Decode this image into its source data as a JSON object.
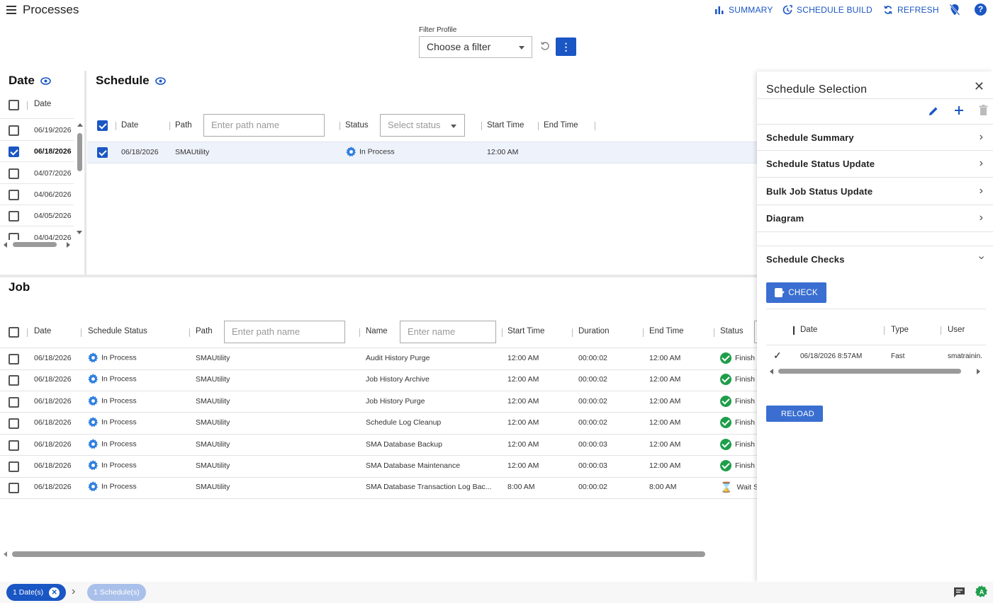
{
  "app": {
    "title": "Processes",
    "actions": {
      "summary": "SUMMARY",
      "schedule_build": "SCHEDULE BUILD",
      "refresh": "REFRESH"
    },
    "accent": "#1a56c4"
  },
  "filter": {
    "label": "Filter Profile",
    "placeholder": "Choose a filter"
  },
  "date_panel": {
    "title": "Date",
    "column": "Date",
    "rows": [
      {
        "date": "06/19/2026",
        "checked": false
      },
      {
        "date": "06/18/2026",
        "checked": true
      },
      {
        "date": "04/07/2026",
        "checked": false
      },
      {
        "date": "04/06/2026",
        "checked": false
      },
      {
        "date": "04/05/2026",
        "checked": false
      },
      {
        "date": "04/04/2026",
        "checked": false
      }
    ]
  },
  "schedule": {
    "title": "Schedule",
    "columns": {
      "date": "Date",
      "path": "Path",
      "status": "Status",
      "start": "Start Time",
      "end": "End Time"
    },
    "path_placeholder": "Enter path name",
    "status_placeholder": "Select status",
    "row": {
      "date": "06/18/2026",
      "path": "SMAUtility",
      "status": "In Process",
      "start": "12:00 AM"
    }
  },
  "job": {
    "title": "Job",
    "columns": {
      "date": "Date",
      "schedule_status": "Schedule Status",
      "path": "Path",
      "name": "Name",
      "start": "Start Time",
      "duration": "Duration",
      "end": "End Time",
      "status": "Status"
    },
    "path_placeholder": "Enter path name",
    "name_placeholder": "Enter name",
    "rows": [
      {
        "date": "06/18/2026",
        "sched_status": "In Process",
        "path": "SMAUtility",
        "name": "Audit History Purge",
        "start": "12:00 AM",
        "duration": "00:00:02",
        "end": "12:00 AM",
        "status": "Finish",
        "status_kind": "done"
      },
      {
        "date": "06/18/2026",
        "sched_status": "In Process",
        "path": "SMAUtility",
        "name": "Job History Archive",
        "start": "12:00 AM",
        "duration": "00:00:02",
        "end": "12:00 AM",
        "status": "Finish",
        "status_kind": "done"
      },
      {
        "date": "06/18/2026",
        "sched_status": "In Process",
        "path": "SMAUtility",
        "name": "Job History Purge",
        "start": "12:00 AM",
        "duration": "00:00:02",
        "end": "12:00 AM",
        "status": "Finish",
        "status_kind": "done"
      },
      {
        "date": "06/18/2026",
        "sched_status": "In Process",
        "path": "SMAUtility",
        "name": "Schedule Log Cleanup",
        "start": "12:00 AM",
        "duration": "00:00:02",
        "end": "12:00 AM",
        "status": "Finish",
        "status_kind": "done"
      },
      {
        "date": "06/18/2026",
        "sched_status": "In Process",
        "path": "SMAUtility",
        "name": "SMA Database Backup",
        "start": "12:00 AM",
        "duration": "00:00:03",
        "end": "12:00 AM",
        "status": "Finish",
        "status_kind": "done"
      },
      {
        "date": "06/18/2026",
        "sched_status": "In Process",
        "path": "SMAUtility",
        "name": "SMA Database Maintenance",
        "start": "12:00 AM",
        "duration": "00:00:03",
        "end": "12:00 AM",
        "status": "Finish",
        "status_kind": "done"
      },
      {
        "date": "06/18/2026",
        "sched_status": "In Process",
        "path": "SMAUtility",
        "name": "SMA Database Transaction Log Bac...",
        "start": "8:00 AM",
        "duration": "00:00:02",
        "end": "8:00 AM",
        "status": "Wait S",
        "status_kind": "wait"
      }
    ]
  },
  "drawer": {
    "title": "Schedule Selection",
    "items": [
      "Schedule Summary",
      "Schedule Status Update",
      "Bulk Job Status Update",
      "Diagram"
    ],
    "checks_title": "Schedule Checks",
    "check_button": "CHECK",
    "checks_columns": {
      "date": "Date",
      "type": "Type",
      "user": "User"
    },
    "check_row": {
      "date": "06/18/2026 8:57AM",
      "type": "Fast",
      "user": "smatrainin."
    },
    "reload_button": "RELOAD"
  },
  "bottom": {
    "dates_chip": "1 Date(s)",
    "schedules_chip": "1 Schedule(s)"
  }
}
